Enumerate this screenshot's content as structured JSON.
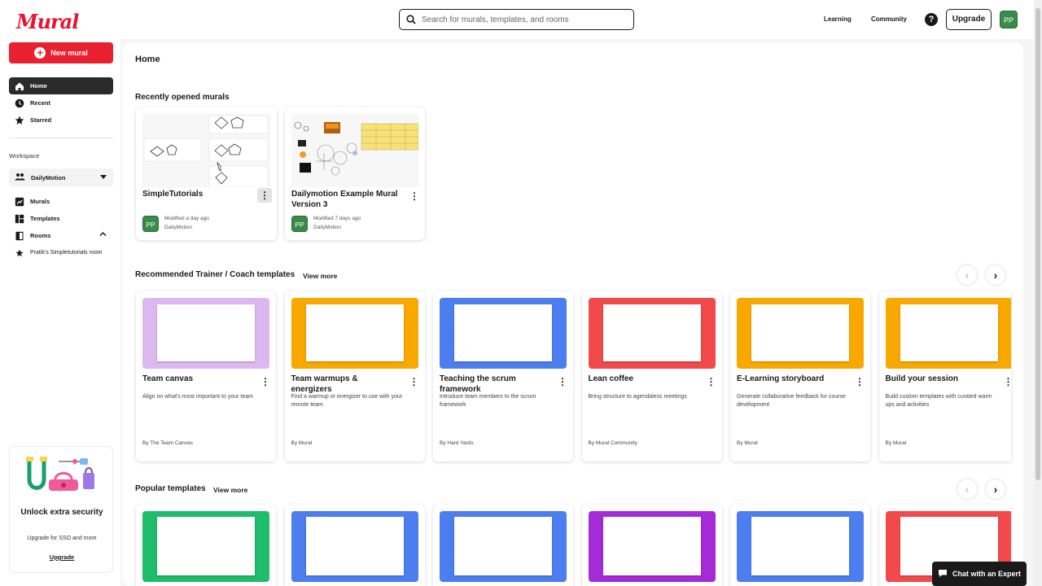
{
  "app": {
    "logo_text": "Mural",
    "search_placeholder": "Search for murals, templates, and rooms",
    "links": {
      "learning": "Learning",
      "community": "Community"
    },
    "help_symbol": "?",
    "upgrade_label": "Upgrade",
    "user_initials": "PP"
  },
  "sidebar": {
    "new_mural_label": "New mural",
    "nav": [
      {
        "label": "Home",
        "icon": "home-icon"
      },
      {
        "label": "Recent",
        "icon": "clock-icon"
      },
      {
        "label": "Starred",
        "icon": "star-icon"
      }
    ],
    "workspace_label": "Workspace",
    "workspace_name": "DailyMotion",
    "workspace_nav": [
      {
        "label": "Murals",
        "icon": "murals-icon"
      },
      {
        "label": "Templates",
        "icon": "templates-icon"
      },
      {
        "label": "Rooms",
        "icon": "rooms-icon"
      },
      {
        "label": "Pratik's Simpletutorials room",
        "icon": "star-icon"
      }
    ],
    "promo": {
      "title": "Unlock extra security",
      "subtitle": "Upgrade for SSO and more",
      "link": "Upgrade"
    }
  },
  "main": {
    "title": "Home",
    "recent": {
      "title": "Recently opened murals",
      "items": [
        {
          "title": "SimpleTutorials",
          "modified": "Modified a day ago",
          "workspace": "DailyMotion",
          "initials": "PP"
        },
        {
          "title": "Dailymotion Example Mural Version 3",
          "modified": "Modified 7 days ago",
          "workspace": "DailyMotion",
          "initials": "PP"
        }
      ]
    },
    "recommended": {
      "title": "Recommended Trainer / Coach templates",
      "view_more": "View more",
      "items": [
        {
          "title": "Team canvas",
          "desc": "Align on what's most important to your team",
          "author": "By The Team Canvas",
          "color": "#dcb8f0"
        },
        {
          "title": "Team warmups & energizers",
          "desc": "Find a warmup or energizer to use with your remote team",
          "author": "By Mural",
          "color": "#f9a800"
        },
        {
          "title": "Teaching the scrum framework",
          "desc": "Introduce team members to the scrum framework",
          "author": "By Hard Yards",
          "color": "#4d7ef0"
        },
        {
          "title": "Lean coffee",
          "desc": "Bring structure to agendaless meetings",
          "author": "By Mural Community",
          "color": "#f24a4a"
        },
        {
          "title": "E-Learning storyboard",
          "desc": "Generate collaborative feedback for course development",
          "author": "By Mural",
          "color": "#f9a800"
        },
        {
          "title": "Build your session",
          "desc": "Build custom templates with curated warm ups and activities",
          "author": "By Mural",
          "color": "#f9a800"
        }
      ]
    },
    "popular": {
      "title": "Popular templates",
      "view_more": "View more",
      "colors": [
        "#1fbd6b",
        "#4d7ef0",
        "#4d7ef0",
        "#a62bd8",
        "#4d7ef0",
        "#f24a4a"
      ]
    },
    "arrows": {
      "prev": "‹",
      "next": "›"
    },
    "kebab_symbol": "⋮"
  },
  "chat_label": "Chat with an Expert"
}
